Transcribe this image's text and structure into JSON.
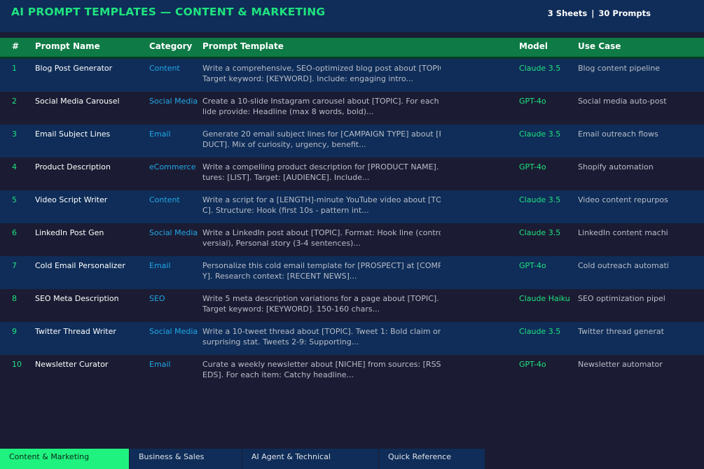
{
  "header": {
    "title": "AI PROMPT TEMPLATES  —  CONTENT & MARKETING",
    "sheets": "3 Sheets",
    "separator": "|",
    "prompts": "30 Prompts"
  },
  "columns": {
    "num": "#",
    "name": "Prompt Name",
    "category": "Category",
    "template": "Prompt Template",
    "model": "Model",
    "use_case": "Use Case"
  },
  "rows": [
    {
      "num": "1",
      "name": "Blog Post Generator",
      "category": "Content",
      "template_l1": "Write a comprehensive, SEO-optimized blog post about [TOPIC].",
      "template_l2": "Target keyword: [KEYWORD]. Include: engaging intro...",
      "model": "Claude 3.5",
      "use_case": "Blog content pipeline"
    },
    {
      "num": "2",
      "name": "Social Media Carousel",
      "category": "Social Media",
      "template_l1": "Create a 10-slide Instagram carousel about [TOPIC]. For each s",
      "template_l2": "lide provide: Headline (max 8 words, bold)...",
      "model": "GPT-4o",
      "use_case": "Social media auto-post"
    },
    {
      "num": "3",
      "name": "Email Subject Lines",
      "category": "Email",
      "template_l1": "Generate 20 email subject lines for [CAMPAIGN TYPE] about [PRO",
      "template_l2": "DUCT]. Mix of curiosity, urgency, benefit...",
      "model": "Claude 3.5",
      "use_case": "Email outreach flows"
    },
    {
      "num": "4",
      "name": "Product Description",
      "category": "eCommerce",
      "template_l1": "Write a compelling product description for [PRODUCT NAME]. Fea",
      "template_l2": "tures: [LIST]. Target: [AUDIENCE]. Include...",
      "model": "GPT-4o",
      "use_case": "Shopify automation"
    },
    {
      "num": "5",
      "name": "Video Script Writer",
      "category": "Content",
      "template_l1": "Write a script for a [LENGTH]-minute YouTube video about [TOPI",
      "template_l2": "C]. Structure: Hook (first 10s - pattern int...",
      "model": "Claude 3.5",
      "use_case": "Video content repurpos"
    },
    {
      "num": "6",
      "name": "LinkedIn Post Gen",
      "category": "Social Media",
      "template_l1": "Write a LinkedIn post about [TOPIC]. Format: Hook line (contro",
      "template_l2": "versial), Personal story (3-4 sentences)...",
      "model": "Claude 3.5",
      "use_case": "LinkedIn content machi"
    },
    {
      "num": "7",
      "name": "Cold Email Personalizer",
      "category": "Email",
      "template_l1": "Personalize this cold email template for [PROSPECT] at [COMPAN",
      "template_l2": "Y]. Research context: [RECENT NEWS]...",
      "model": "GPT-4o",
      "use_case": "Cold outreach automati"
    },
    {
      "num": "8",
      "name": "SEO Meta Description",
      "category": "SEO",
      "template_l1": "Write 5 meta description variations for a page about [TOPIC].",
      "template_l2": "Target keyword: [KEYWORD]. 150-160 chars...",
      "model": "Claude Haiku",
      "use_case": "SEO optimization pipel"
    },
    {
      "num": "9",
      "name": "Twitter Thread Writer",
      "category": "Social Media",
      "template_l1": "Write a 10-tweet thread about [TOPIC]. Tweet 1: Bold claim or",
      "template_l2": "surprising stat. Tweets 2-9: Supporting...",
      "model": "Claude 3.5",
      "use_case": "Twitter thread generat"
    },
    {
      "num": "10",
      "name": "Newsletter Curator",
      "category": "Email",
      "template_l1": "Curate a weekly newsletter about [NICHE] from sources: [RSS FE",
      "template_l2": "EDS]. For each item: Catchy headline...",
      "model": "GPT-4o",
      "use_case": "Newsletter automator"
    }
  ],
  "tabs": [
    {
      "label": "Content & Marketing",
      "active": true
    },
    {
      "label": "Business & Sales",
      "active": false
    },
    {
      "label": "AI Agent & Technical",
      "active": false
    },
    {
      "label": "Quick Reference",
      "active": false
    }
  ],
  "colors": {
    "accent_green": "#1fe37f",
    "header_band": "#0e7a45",
    "row_blue": "#0f2d58",
    "row_dark": "#1b1c33",
    "category_blue": "#21a7e8"
  }
}
